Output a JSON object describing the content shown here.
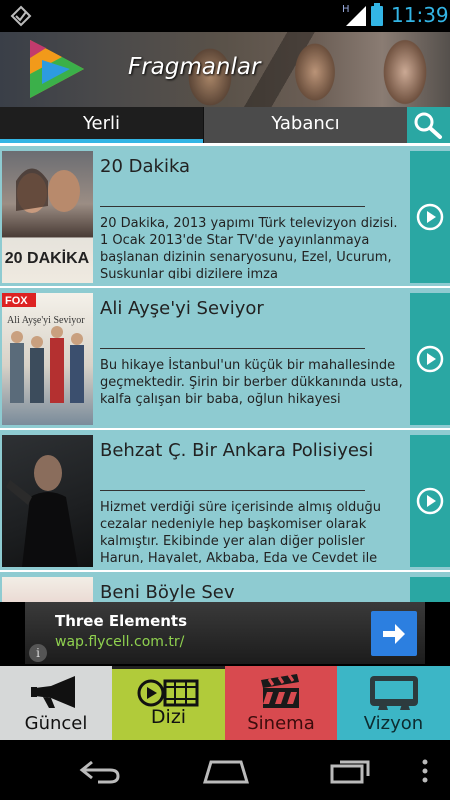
{
  "status_bar": {
    "network_label": "H",
    "time": "11:39",
    "icons": [
      "notification-icon",
      "signal-icon",
      "battery-icon"
    ]
  },
  "header": {
    "title": "Fragmanlar",
    "logo_icon": "play-logo-icon"
  },
  "tabs": [
    {
      "label": "Yerli",
      "selected": true
    },
    {
      "label": "Yabancı",
      "selected": false
    }
  ],
  "search_icon": "search-icon",
  "list": [
    {
      "title": "20 Dakika",
      "description": "20 Dakika, 2013 yapımı Türk televizyon dizisi. 1 Ocak 2013'de Star TV'de yayınlanmaya başlanan dizinin senaryosunu, Ezel, Ucurum, Suskunlar gibi dizilere imza"
    },
    {
      "title": "Ali Ayşe'yi Seviyor",
      "description": "Bu hikaye İstanbul'un küçük bir mahallesinde geçmektedir. Şirin bir berber dükkanında usta, kalfa çalışan bir baba, oğlun hikayesi"
    },
    {
      "title": "Behzat Ç. Bir Ankara Polisiyesi",
      "description": "Hizmet verdiği süre içerisinde almış olduğu cezalar nedeniyle hep başkomiser olarak kalmıştır. Ekibinde yer alan diğer polisler Harun, Hayalet, Akbaba, Eda ve Cevdet ile"
    },
    {
      "title": "Beni Böyle Sev",
      "description": ""
    }
  ],
  "ad": {
    "title": "Three Elements",
    "url": "wap.flycell.com.tr/",
    "info": "i"
  },
  "bottom_nav": [
    {
      "label": "Güncel",
      "icon": "megaphone-icon",
      "color": "#d6d8d8"
    },
    {
      "label": "Dizi",
      "icon": "film-reel-icon",
      "color": "#b1cb3a"
    },
    {
      "label": "Sinema",
      "icon": "clapperboard-icon",
      "color": "#d84a4f"
    },
    {
      "label": "Vizyon",
      "icon": "cinema-screen-icon",
      "color": "#3cb6c6"
    }
  ],
  "colors": {
    "accent": "#33b5e5",
    "teal": "#2aa7a3",
    "row_bg": "#8ecbd1"
  }
}
